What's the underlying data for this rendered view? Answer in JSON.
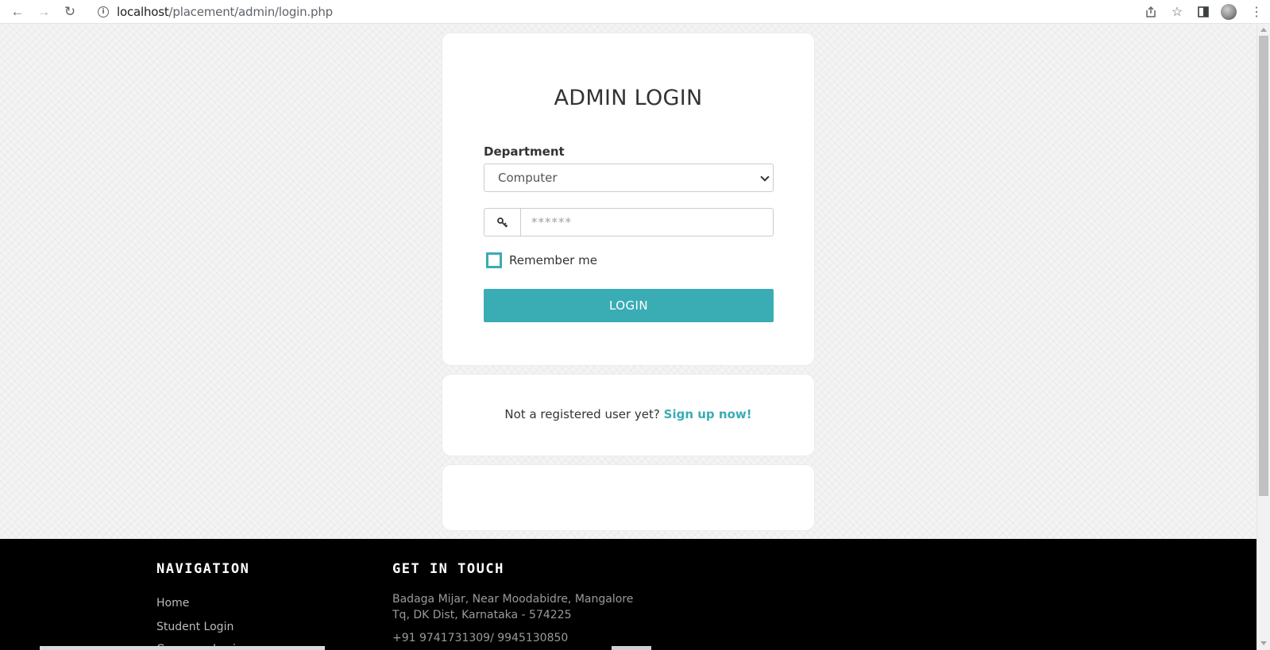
{
  "browser": {
    "url_host": "localhost",
    "url_path": "/placement/admin/login.php"
  },
  "login": {
    "title": "ADMIN LOGIN",
    "department_label": "Department",
    "department_value": "Computer",
    "password_placeholder": "******",
    "remember_label": "Remember me",
    "login_button": "LOGIN"
  },
  "signup": {
    "prompt": "Not a registered user yet?",
    "link": "Sign up now!"
  },
  "footer": {
    "nav_heading": "NAVIGATION",
    "nav_links": [
      "Home",
      "Student Login",
      "Company Login"
    ],
    "contact_heading": "GET IN TOUCH",
    "address_line1": "Badaga Mijar, Near Moodabidre, Mangalore",
    "address_line2": "Tq, DK Dist, Karnataka - 574225",
    "phone": "+91 9741731309/ 9945130850"
  },
  "colors": {
    "accent": "#3aacb4",
    "footer_bg": "#000000"
  },
  "icons": {
    "back": "arrow-left-icon",
    "forward": "arrow-right-icon",
    "reload": "reload-icon",
    "info": "info-icon",
    "share": "share-icon",
    "bookmark": "star-icon",
    "sidepanel": "side-panel-icon",
    "menu": "kebab-menu-icon",
    "password": "key-icon"
  }
}
